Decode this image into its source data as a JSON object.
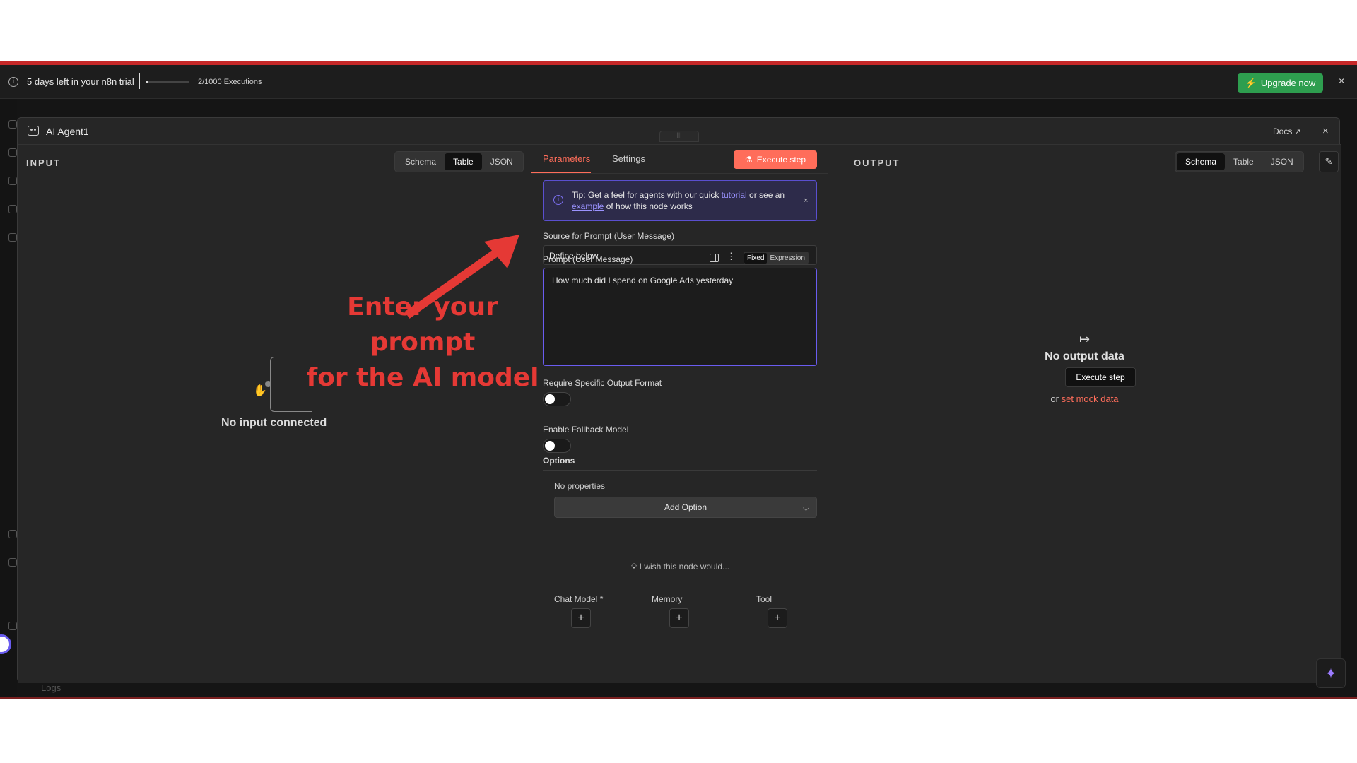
{
  "trial": {
    "message": "5 days left in your n8n trial",
    "executions": "2/1000 Executions",
    "executions_used": 2,
    "executions_total": 1000,
    "upgrade_label": "Upgrade now",
    "close": "×"
  },
  "logs_label": "Logs",
  "node": {
    "title": "AI Agent1",
    "docs_label": "Docs",
    "close": "×"
  },
  "input_panel": {
    "title": "INPUT",
    "views": [
      "Schema",
      "Table",
      "JSON"
    ],
    "active_view": "Table",
    "empty_text": "No input connected"
  },
  "annotation": {
    "line1": "Enter your prompt",
    "line2": "for the AI model",
    "color": "#e53935"
  },
  "params_panel": {
    "tabs": [
      "Parameters",
      "Settings"
    ],
    "active_tab": "Parameters",
    "execute_label": "Execute step",
    "tip": {
      "prefix": "Tip: Get a feel for agents with our quick ",
      "link1": "tutorial",
      "middle": " or see an ",
      "link2": "example",
      "suffix": " of how this node works"
    },
    "source_label": "Source for Prompt (User Message)",
    "source_value": "Define below",
    "prompt_label": "Prompt (User Message)",
    "mode_options": [
      "Fixed",
      "Expression"
    ],
    "mode_active": "Fixed",
    "prompt_value": "How much did I spend on Google Ads yesterday",
    "require_format_label": "Require Specific Output Format",
    "require_format_on": false,
    "fallback_label": "Enable Fallback Model",
    "fallback_on": false,
    "options_label": "Options",
    "no_properties": "No properties",
    "add_option_label": "Add Option",
    "wish_text": "I wish this node would...",
    "sub_nodes": [
      "Chat Model *",
      "Memory",
      "Tool"
    ],
    "plus": "+"
  },
  "output_panel": {
    "title": "OUTPUT",
    "views": [
      "Schema",
      "Table",
      "JSON"
    ],
    "active_view": "Schema",
    "empty_title": "No output data",
    "execute_label": "Execute step",
    "or_text": "or ",
    "mock_link": "set mock data"
  },
  "colors": {
    "accent": "#ff6d5a",
    "upgrade": "#2e9e4f",
    "tip_border": "#5a4fcf",
    "background": "#262626"
  }
}
